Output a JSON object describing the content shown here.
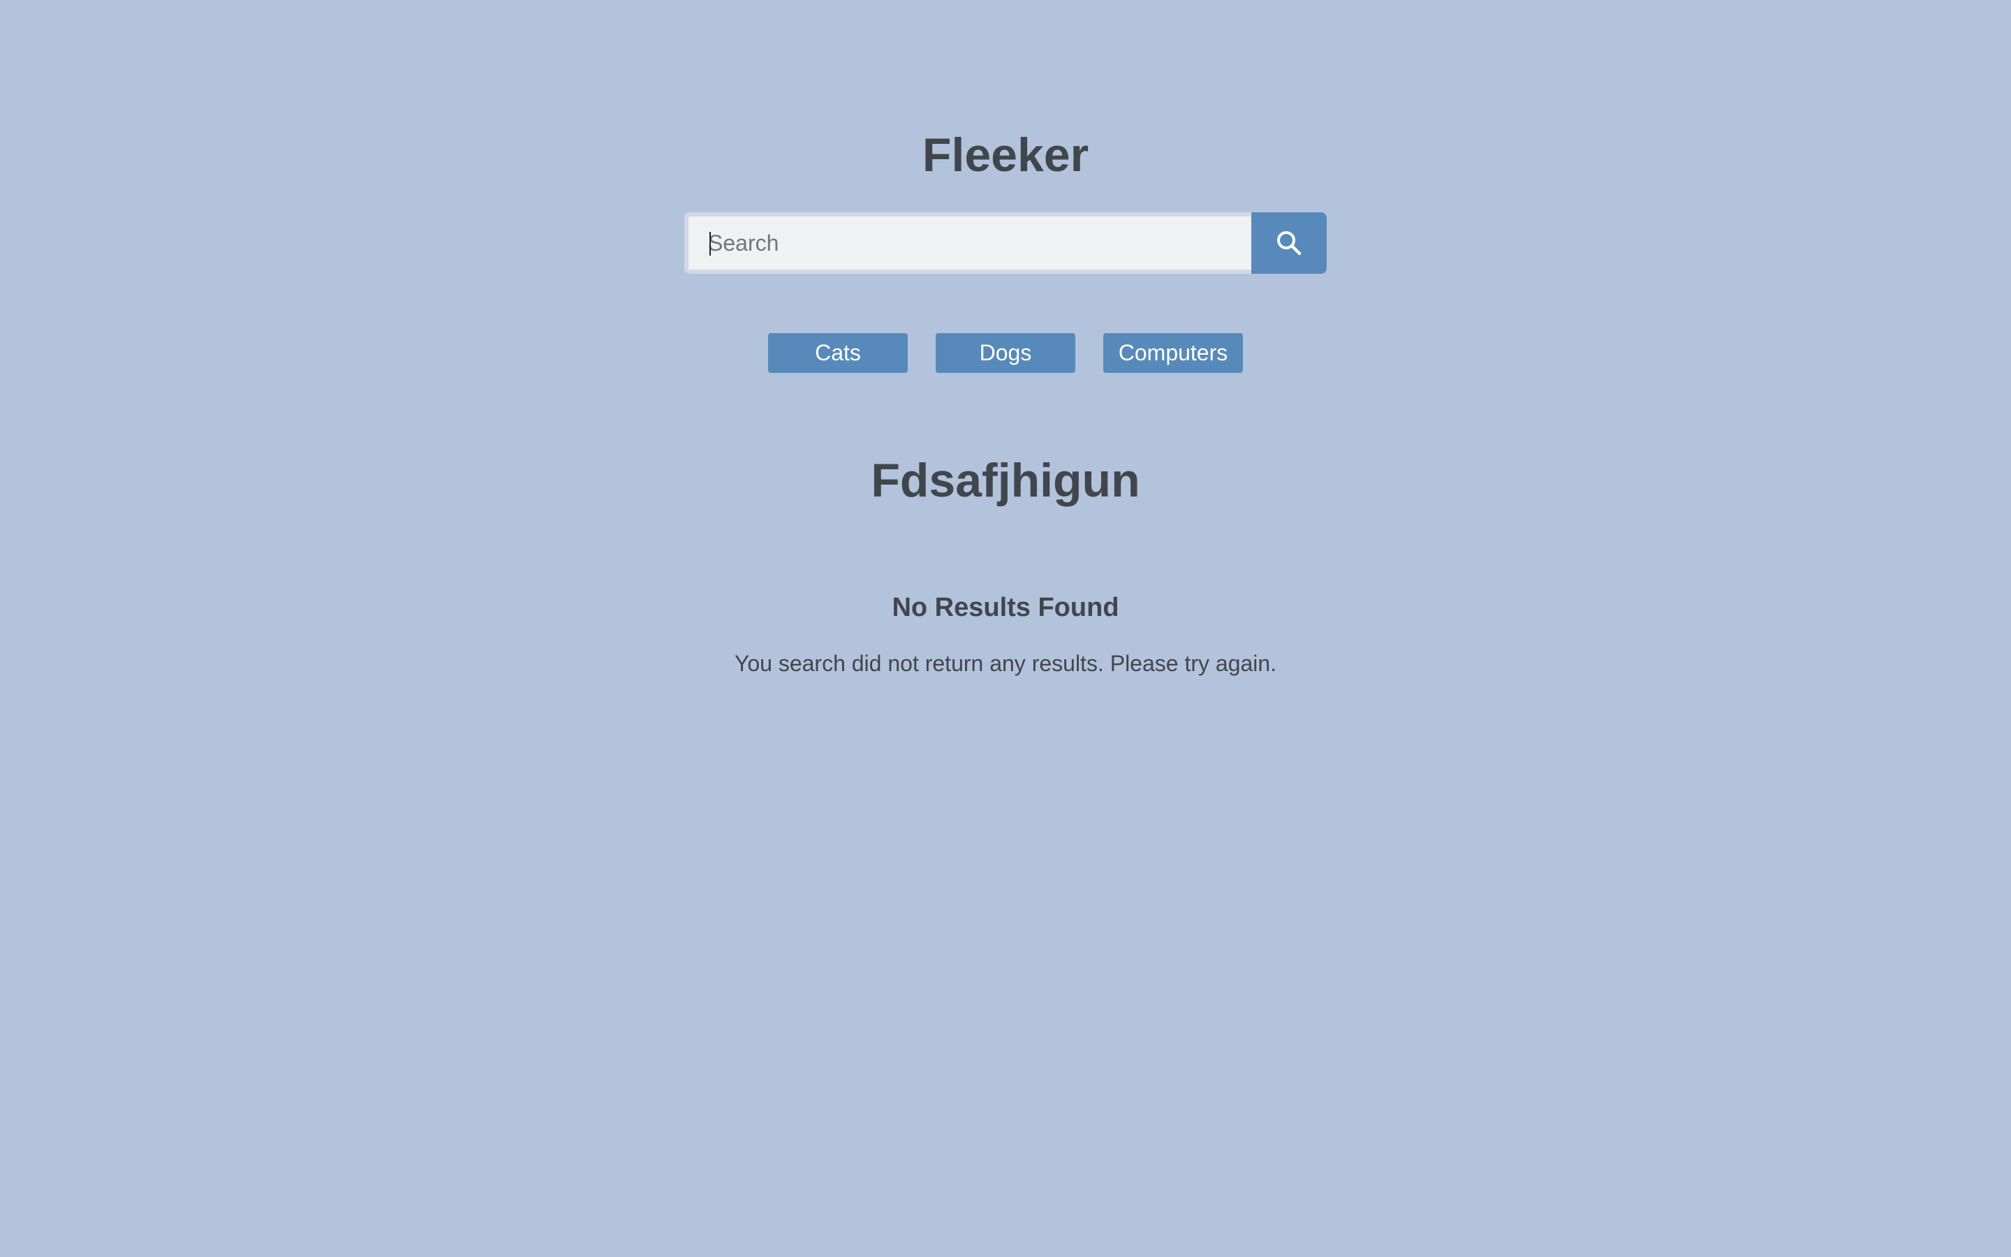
{
  "app": {
    "title": "Fleeker"
  },
  "search": {
    "value": "",
    "placeholder": "Search",
    "button_icon": "search-icon"
  },
  "categories": [
    {
      "label": "Cats"
    },
    {
      "label": "Dogs"
    },
    {
      "label": "Computers"
    }
  ],
  "results": {
    "query_heading": "Fdsafjhigun",
    "empty_title": "No Results Found",
    "empty_message": "You search did not return any results. Please try again."
  },
  "colors": {
    "background": "#b3c3dc",
    "accent": "#5789bb",
    "text": "#41464d",
    "input_background": "#f0f1f2"
  }
}
